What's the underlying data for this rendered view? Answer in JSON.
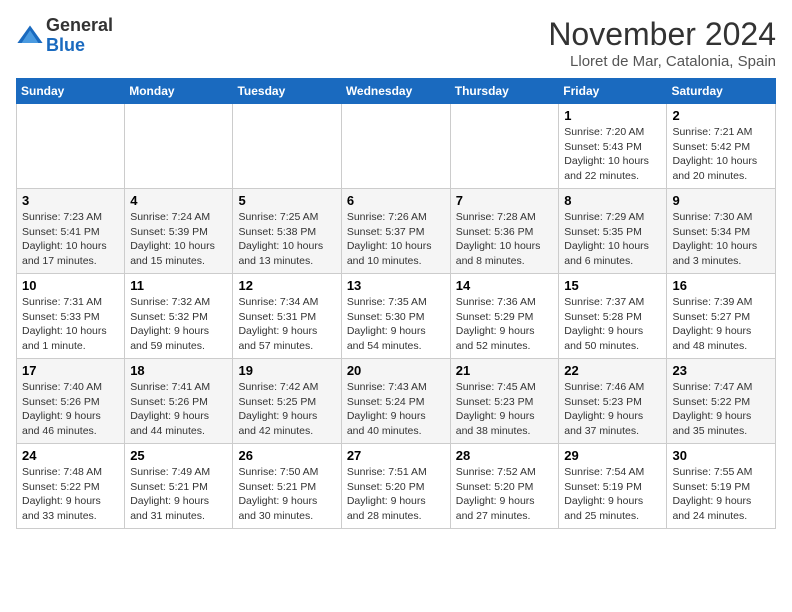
{
  "header": {
    "logo_line1": "General",
    "logo_line2": "Blue",
    "month_title": "November 2024",
    "subtitle": "Lloret de Mar, Catalonia, Spain"
  },
  "weekdays": [
    "Sunday",
    "Monday",
    "Tuesday",
    "Wednesday",
    "Thursday",
    "Friday",
    "Saturday"
  ],
  "weeks": [
    [
      {
        "day": "",
        "info": ""
      },
      {
        "day": "",
        "info": ""
      },
      {
        "day": "",
        "info": ""
      },
      {
        "day": "",
        "info": ""
      },
      {
        "day": "",
        "info": ""
      },
      {
        "day": "1",
        "info": "Sunrise: 7:20 AM\nSunset: 5:43 PM\nDaylight: 10 hours and 22 minutes."
      },
      {
        "day": "2",
        "info": "Sunrise: 7:21 AM\nSunset: 5:42 PM\nDaylight: 10 hours and 20 minutes."
      }
    ],
    [
      {
        "day": "3",
        "info": "Sunrise: 7:23 AM\nSunset: 5:41 PM\nDaylight: 10 hours and 17 minutes."
      },
      {
        "day": "4",
        "info": "Sunrise: 7:24 AM\nSunset: 5:39 PM\nDaylight: 10 hours and 15 minutes."
      },
      {
        "day": "5",
        "info": "Sunrise: 7:25 AM\nSunset: 5:38 PM\nDaylight: 10 hours and 13 minutes."
      },
      {
        "day": "6",
        "info": "Sunrise: 7:26 AM\nSunset: 5:37 PM\nDaylight: 10 hours and 10 minutes."
      },
      {
        "day": "7",
        "info": "Sunrise: 7:28 AM\nSunset: 5:36 PM\nDaylight: 10 hours and 8 minutes."
      },
      {
        "day": "8",
        "info": "Sunrise: 7:29 AM\nSunset: 5:35 PM\nDaylight: 10 hours and 6 minutes."
      },
      {
        "day": "9",
        "info": "Sunrise: 7:30 AM\nSunset: 5:34 PM\nDaylight: 10 hours and 3 minutes."
      }
    ],
    [
      {
        "day": "10",
        "info": "Sunrise: 7:31 AM\nSunset: 5:33 PM\nDaylight: 10 hours and 1 minute."
      },
      {
        "day": "11",
        "info": "Sunrise: 7:32 AM\nSunset: 5:32 PM\nDaylight: 9 hours and 59 minutes."
      },
      {
        "day": "12",
        "info": "Sunrise: 7:34 AM\nSunset: 5:31 PM\nDaylight: 9 hours and 57 minutes."
      },
      {
        "day": "13",
        "info": "Sunrise: 7:35 AM\nSunset: 5:30 PM\nDaylight: 9 hours and 54 minutes."
      },
      {
        "day": "14",
        "info": "Sunrise: 7:36 AM\nSunset: 5:29 PM\nDaylight: 9 hours and 52 minutes."
      },
      {
        "day": "15",
        "info": "Sunrise: 7:37 AM\nSunset: 5:28 PM\nDaylight: 9 hours and 50 minutes."
      },
      {
        "day": "16",
        "info": "Sunrise: 7:39 AM\nSunset: 5:27 PM\nDaylight: 9 hours and 48 minutes."
      }
    ],
    [
      {
        "day": "17",
        "info": "Sunrise: 7:40 AM\nSunset: 5:26 PM\nDaylight: 9 hours and 46 minutes."
      },
      {
        "day": "18",
        "info": "Sunrise: 7:41 AM\nSunset: 5:26 PM\nDaylight: 9 hours and 44 minutes."
      },
      {
        "day": "19",
        "info": "Sunrise: 7:42 AM\nSunset: 5:25 PM\nDaylight: 9 hours and 42 minutes."
      },
      {
        "day": "20",
        "info": "Sunrise: 7:43 AM\nSunset: 5:24 PM\nDaylight: 9 hours and 40 minutes."
      },
      {
        "day": "21",
        "info": "Sunrise: 7:45 AM\nSunset: 5:23 PM\nDaylight: 9 hours and 38 minutes."
      },
      {
        "day": "22",
        "info": "Sunrise: 7:46 AM\nSunset: 5:23 PM\nDaylight: 9 hours and 37 minutes."
      },
      {
        "day": "23",
        "info": "Sunrise: 7:47 AM\nSunset: 5:22 PM\nDaylight: 9 hours and 35 minutes."
      }
    ],
    [
      {
        "day": "24",
        "info": "Sunrise: 7:48 AM\nSunset: 5:22 PM\nDaylight: 9 hours and 33 minutes."
      },
      {
        "day": "25",
        "info": "Sunrise: 7:49 AM\nSunset: 5:21 PM\nDaylight: 9 hours and 31 minutes."
      },
      {
        "day": "26",
        "info": "Sunrise: 7:50 AM\nSunset: 5:21 PM\nDaylight: 9 hours and 30 minutes."
      },
      {
        "day": "27",
        "info": "Sunrise: 7:51 AM\nSunset: 5:20 PM\nDaylight: 9 hours and 28 minutes."
      },
      {
        "day": "28",
        "info": "Sunrise: 7:52 AM\nSunset: 5:20 PM\nDaylight: 9 hours and 27 minutes."
      },
      {
        "day": "29",
        "info": "Sunrise: 7:54 AM\nSunset: 5:19 PM\nDaylight: 9 hours and 25 minutes."
      },
      {
        "day": "30",
        "info": "Sunrise: 7:55 AM\nSunset: 5:19 PM\nDaylight: 9 hours and 24 minutes."
      }
    ]
  ]
}
